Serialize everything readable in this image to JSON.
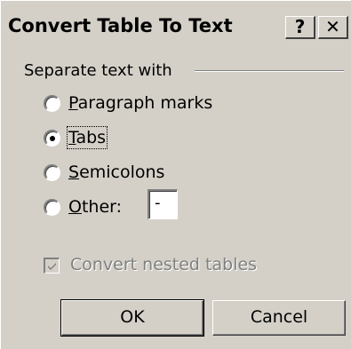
{
  "window": {
    "title": "Convert Table To Text",
    "help_label": "?",
    "close_label": "✕"
  },
  "group": {
    "label": "Separate text with"
  },
  "options": [
    {
      "label": "Paragraph marks",
      "accelerator": "P",
      "checked": false
    },
    {
      "label": "Tabs",
      "accelerator": "T",
      "checked": true
    },
    {
      "label": "Semicolons",
      "accelerator": "S",
      "checked": false
    },
    {
      "label": "Other:",
      "accelerator": "O",
      "checked": false
    }
  ],
  "other_input": {
    "value": "-"
  },
  "nested": {
    "label": "Convert nested tables",
    "checked": true,
    "enabled": false
  },
  "buttons": {
    "ok_label": "OK",
    "cancel_label": "Cancel"
  },
  "colors": {
    "dialog_face": "#d4d0c8",
    "disabled_text": "#808080"
  }
}
